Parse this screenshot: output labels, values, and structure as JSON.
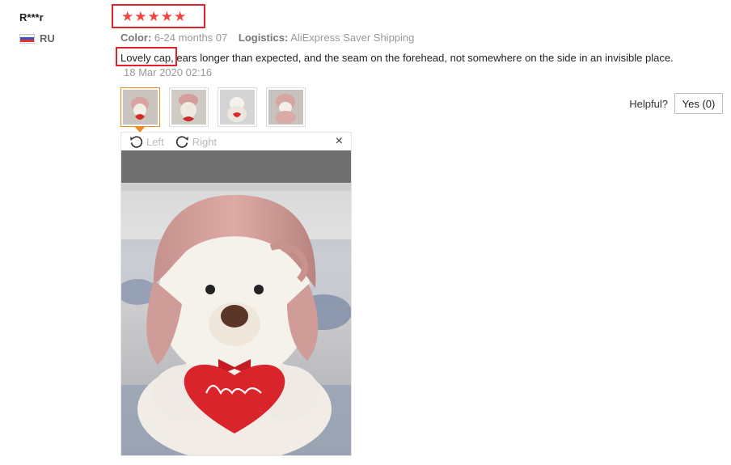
{
  "review": {
    "user_name": "R***r",
    "country": "RU",
    "rating": 5,
    "color_label": "Color:",
    "color_value": "6-24 months 07",
    "logistics_label": "Logistics:",
    "logistics_value": "AliExpress Saver Shipping",
    "text_highlight": "Lovely cap,",
    "text_rest": " ears longer than expected, and the seam on the forehead, not somewhere on the side in an invisible place.",
    "date": "18 Mar 2020 02:16",
    "helpful_label": "Helpful?",
    "yes_label": "Yes (0)"
  },
  "viewer": {
    "left_label": "Left",
    "right_label": "Right",
    "close_symbol": "×"
  },
  "thumbnails": [
    {
      "id": "photo-1",
      "active": true
    },
    {
      "id": "photo-2",
      "active": false
    },
    {
      "id": "photo-3",
      "active": false
    },
    {
      "id": "photo-4",
      "active": false
    }
  ],
  "colors": {
    "highlight_border": "#e0232a",
    "star": "#f0453a",
    "active_thumb": "#f08a24"
  },
  "icons": [
    "star-icon",
    "flag-icon",
    "rotate-left-icon",
    "rotate-right-icon",
    "close-icon"
  ]
}
